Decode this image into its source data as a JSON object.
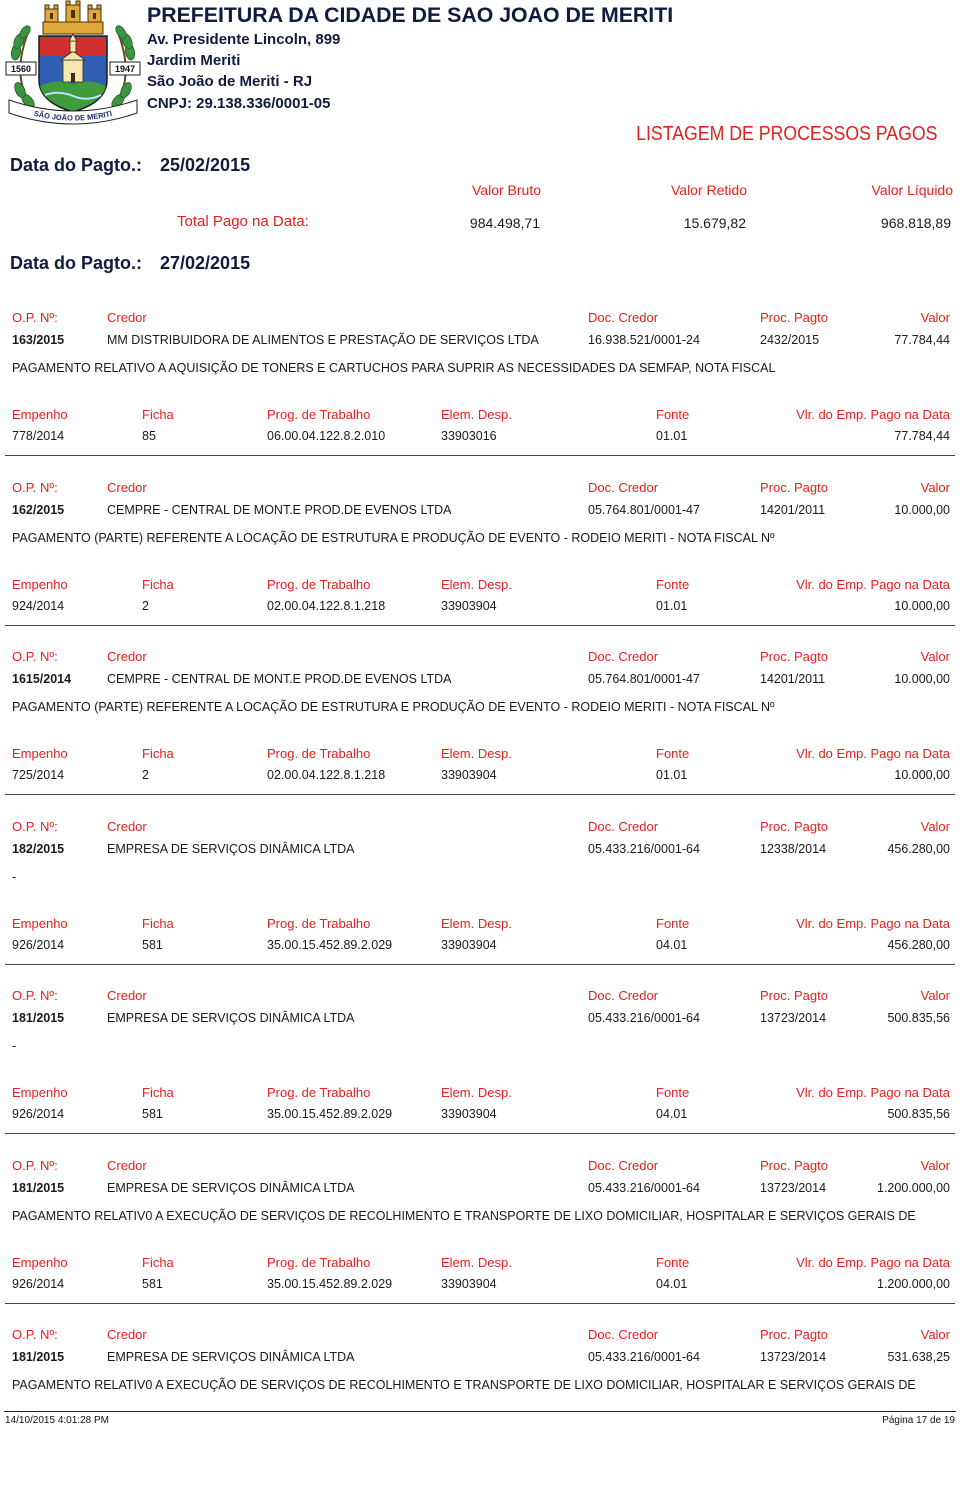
{
  "header": {
    "title": "PREFEITURA DA CIDADE DE SAO JOAO DE MERITI",
    "address": "Av. Presidente Lincoln, 899",
    "district": "Jardim Meriti",
    "city": "São João de Meriti - RJ",
    "cnpj": "CNPJ: 29.138.336/0001-05",
    "report_title": "LISTAGEM DE PROCESSOS PAGOS"
  },
  "logo": {
    "icon": "coat-of-arms",
    "year_left": "1560",
    "year_right": "1947",
    "ribbon_text": "SÃO JOÃO DE MERITI"
  },
  "summary": {
    "date_label": "Data do Pagto.:",
    "date": "25/02/2015",
    "col_bruto": "Valor Bruto",
    "col_retido": "Valor Retido",
    "col_liquido": "Valor Líquido",
    "total_label": "Total Pago na Data:",
    "bruto": "984.498,71",
    "retido": "15.679,82",
    "liquido": "968.818,89"
  },
  "section": {
    "date_label": "Data do Pagto.:",
    "date": "27/02/2015"
  },
  "labels": {
    "op": "O.P. Nº:",
    "credor": "Credor",
    "doc_credor": "Doc. Credor",
    "proc_pagto": "Proc. Pagto",
    "valor": "Valor",
    "empenho": "Empenho",
    "ficha": "Ficha",
    "prog_trabalho": "Prog. de Trabalho",
    "elem_desp": "Elem. Desp.",
    "fonte": "Fonte",
    "vlr_emp": "Vlr. do Emp. Pago na Data"
  },
  "payments": [
    {
      "op": "163/2015",
      "credor": "MM DISTRIBUIDORA DE ALIMENTOS E PRESTAÇÃO DE SERVIÇOS LTDA",
      "doc": "16.938.521/0001-24",
      "proc": "2432/2015",
      "valor": "77.784,44",
      "descricao": "PAGAMENTO RELATIVO A AQUISIÇÃO DE TONERS E CARTUCHOS PARA SUPRIR AS NECESSIDADES DA SEMFAP, NOTA FISCAL",
      "empenho": {
        "numero": "778/2014",
        "ficha": "85",
        "prog": "06.00.04.122.8.2.010",
        "elem": "33903016",
        "fonte": "01.01",
        "valor": "77.784,44"
      }
    },
    {
      "op": "162/2015",
      "credor": "CEMPRE - CENTRAL DE MONT.E PROD.DE EVENOS LTDA",
      "doc": "05.764.801/0001-47",
      "proc": "14201/2011",
      "valor": "10.000,00",
      "descricao": "PAGAMENTO (PARTE) REFERENTE A LOCAÇÃO DE ESTRUTURA E PRODUÇÃO DE EVENTO - RODEIO MERITI - NOTA FISCAL Nº",
      "empenho": {
        "numero": "924/2014",
        "ficha": "2",
        "prog": "02.00.04.122.8.1.218",
        "elem": "33903904",
        "fonte": "01.01",
        "valor": "10.000,00"
      }
    },
    {
      "op": "1615/2014",
      "credor": "CEMPRE - CENTRAL DE MONT.E PROD.DE EVENOS LTDA",
      "doc": "05.764.801/0001-47",
      "proc": "14201/2011",
      "valor": "10.000,00",
      "descricao": "PAGAMENTO (PARTE) REFERENTE A LOCAÇÃO DE ESTRUTURA E PRODUÇÃO DE EVENTO - RODEIO MERITI - NOTA FISCAL Nº",
      "empenho": {
        "numero": "725/2014",
        "ficha": "2",
        "prog": "02.00.04.122.8.1.218",
        "elem": "33903904",
        "fonte": "01.01",
        "valor": "10.000,00"
      }
    },
    {
      "op": "182/2015",
      "credor": "EMPRESA DE SERVIÇOS DINÂMICA LTDA",
      "doc": "05.433.216/0001-64",
      "proc": "12338/2014",
      "valor": "456.280,00",
      "descricao": "-",
      "empenho": {
        "numero": "926/2014",
        "ficha": "581",
        "prog": "35.00.15.452.89.2.029",
        "elem": "33903904",
        "fonte": "04.01",
        "valor": "456.280,00"
      }
    },
    {
      "op": "181/2015",
      "credor": "EMPRESA DE SERVIÇOS DINÂMICA LTDA",
      "doc": "05.433.216/0001-64",
      "proc": "13723/2014",
      "valor": "500.835,56",
      "descricao": "-",
      "empenho": {
        "numero": "926/2014",
        "ficha": "581",
        "prog": "35.00.15.452.89.2.029",
        "elem": "33903904",
        "fonte": "04.01",
        "valor": "500.835,56"
      }
    },
    {
      "op": "181/2015",
      "credor": "EMPRESA DE SERVIÇOS DINÂMICA LTDA",
      "doc": "05.433.216/0001-64",
      "proc": "13723/2014",
      "valor": "1.200.000,00",
      "descricao": "PAGAMENTO RELATIV0 A EXECUÇÃO DE SERVIÇOS DE RECOLHIMENTO E TRANSPORTE DE LIXO DOMICILIAR, HOSPITALAR E SERVIÇOS GERAIS DE",
      "empenho": {
        "numero": "926/2014",
        "ficha": "581",
        "prog": "35.00.15.452.89.2.029",
        "elem": "33903904",
        "fonte": "04.01",
        "valor": "1.200.000,00"
      }
    },
    {
      "op": "181/2015",
      "credor": "EMPRESA DE SERVIÇOS DINÂMICA LTDA",
      "doc": "05.433.216/0001-64",
      "proc": "13723/2014",
      "valor": "531.638,25",
      "descricao": "PAGAMENTO RELATIV0 A EXECUÇÃO DE SERVIÇOS DE RECOLHIMENTO E TRANSPORTE DE LIXO DOMICILIAR, HOSPITALAR E SERVIÇOS GERAIS DE"
    }
  ],
  "footer": {
    "printed_at": "14/10/2015 4:01:28 PM",
    "page": "Página 17 de 19"
  },
  "colors": {
    "label_red": "#e3211f",
    "header_navy": "#121a3e",
    "text": "#1a1a1a"
  }
}
